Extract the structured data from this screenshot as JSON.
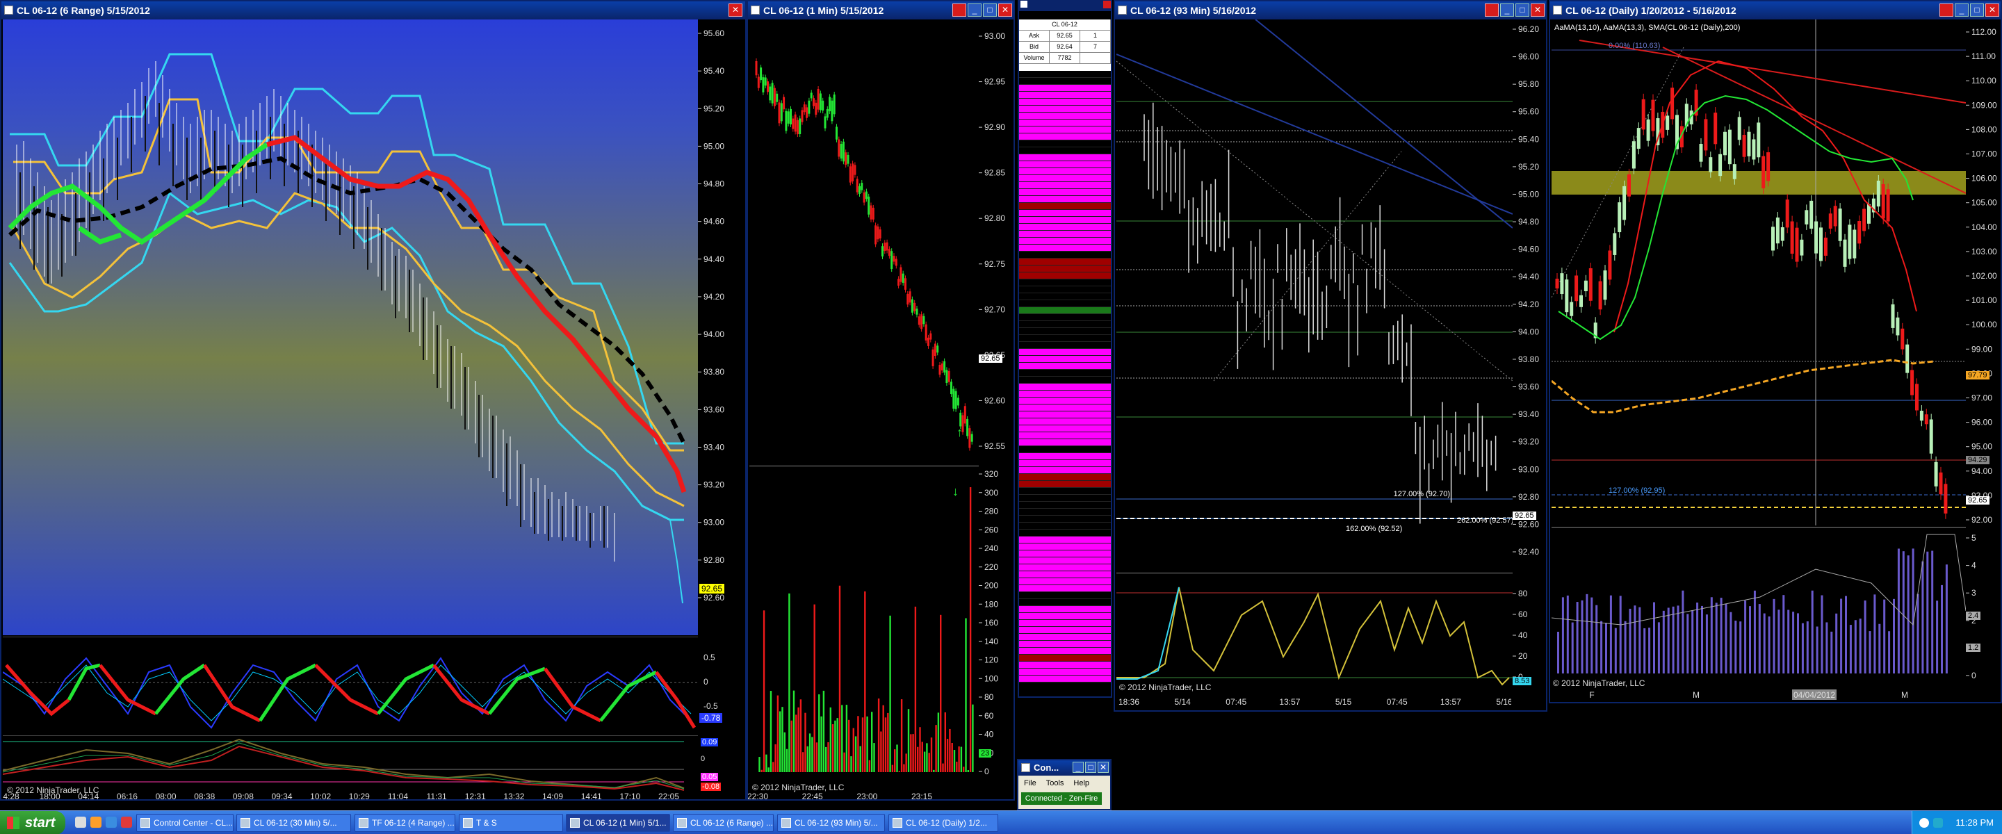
{
  "windows": {
    "range": {
      "title": "CL 06-12 (6 Range)  5/15/2012",
      "copyright": "© 2012 NinjaTrader, LLC",
      "price_ticks": [
        "95.60",
        "95.40",
        "95.20",
        "95.00",
        "94.80",
        "94.60",
        "94.40",
        "94.20",
        "94.00",
        "93.80",
        "93.60",
        "93.40",
        "93.20",
        "93.00",
        "92.80",
        "92.60"
      ],
      "last_price": "92.65",
      "osc_ticks": [
        "0.5",
        "0",
        "-0.5"
      ],
      "osc_value": "-0.78",
      "osc2_values": [
        "0.09",
        "0.05",
        "-0.08"
      ],
      "time_ticks": [
        "4:28",
        "18:00",
        "04:14",
        "06:16",
        "08:00",
        "08:38",
        "09:08",
        "09:34",
        "10:02",
        "10:29",
        "11:04",
        "11:31",
        "12:31",
        "13:32",
        "14:09",
        "14:41",
        "17:10",
        "22:05"
      ]
    },
    "min1": {
      "title": "CL 06-12 (1 Min)  5/15/2012",
      "copyright": "© 2012 NinjaTrader, LLC",
      "price_ticks": [
        "93.00",
        "92.95",
        "92.90",
        "92.85",
        "92.80",
        "92.75",
        "92.70",
        "92.65",
        "92.60",
        "92.55"
      ],
      "last_price": "92.65",
      "vol_ticks": [
        "320",
        "300",
        "280",
        "260",
        "240",
        "220",
        "200",
        "180",
        "160",
        "140",
        "120",
        "100",
        "80",
        "60",
        "40",
        "20",
        "0"
      ],
      "vol_value": "23",
      "time_ticks": [
        "22:30",
        "22:45",
        "23:00",
        "23:15"
      ]
    },
    "min93": {
      "title": "CL 06-12 (93 Min)  5/16/2012",
      "copyright": "© 2012 NinjaTrader, LLC",
      "price_ticks": [
        "96.20",
        "96.00",
        "95.80",
        "95.60",
        "95.40",
        "95.20",
        "95.00",
        "94.80",
        "94.60",
        "94.40",
        "94.20",
        "94.00",
        "93.80",
        "93.60",
        "93.40",
        "93.20",
        "93.00",
        "92.80",
        "92.60",
        "92.40"
      ],
      "fib1": "127.00% (92.70)",
      "fib2": "162.00% (92.52)",
      "fib3": "262.00% (92.57)",
      "last_price": "92.65",
      "osc_ticks": [
        "80",
        "60",
        "40",
        "20",
        "0"
      ],
      "osc_value": "8.53",
      "time_ticks": [
        "18:36",
        "5/14",
        "07:45",
        "13:57",
        "5/15",
        "07:45",
        "13:57",
        "5/16"
      ]
    },
    "daily": {
      "title": "CL 06-12 (Daily)  1/20/2012 - 5/16/2012",
      "indicator_label": "AaMA(13,10), AaMA(13,3), SMA(CL 06-12 (Daily),200)",
      "fib_top": "0.00% (110.63)",
      "fib_bottom": "127.00% (92.95)",
      "copyright": "© 2012 NinjaTrader, LLC",
      "price_ticks": [
        "112.00",
        "111.00",
        "110.00",
        "109.00",
        "108.00",
        "107.00",
        "106.00",
        "105.00",
        "104.00",
        "103.00",
        "102.00",
        "101.00",
        "100.00",
        "99.00",
        "98.00",
        "97.00",
        "96.00",
        "95.00",
        "94.00",
        "93.00",
        "92.00"
      ],
      "sma_value": "97.79",
      "prev_value": "94.29",
      "last_price": "92.65",
      "vol_ticks": [
        "5",
        "4",
        "3",
        "2",
        "1",
        "0"
      ],
      "vol_values": [
        "2.4",
        "1.2"
      ],
      "time_ticks": [
        "F",
        "M",
        "04/04/2012",
        "M"
      ]
    }
  },
  "tape": {
    "header": [
      [
        "CL 06-12",
        ""
      ],
      [
        "Ask",
        "92.65",
        "1"
      ],
      [
        "Bid",
        "92.64",
        "7"
      ],
      [
        "Volume",
        "7782",
        ""
      ]
    ]
  },
  "control_center": {
    "title": "Con...",
    "menu": [
      "File",
      "Tools",
      "Help"
    ],
    "status": "Connected - Zen-Fire"
  },
  "taskbar": {
    "start": "start",
    "tasks": [
      "Control Center - CL...",
      "CL 06-12 (30 Min) 5/...",
      "TF 06-12 (4 Range) ...",
      "T & S",
      "CL 06-12 (1 Min) 5/1...",
      "CL 06-12 (6 Range) ...",
      "CL 06-12 (93 Min) 5/...",
      "CL 06-12 (Daily) 1/2..."
    ],
    "clock": "11:28 PM"
  },
  "colors": {
    "accent": "#0a246a",
    "up": "#22ff22",
    "down": "#ff2020",
    "range_top": "#2b3fd6",
    "range_mid": "#6b7a48"
  }
}
